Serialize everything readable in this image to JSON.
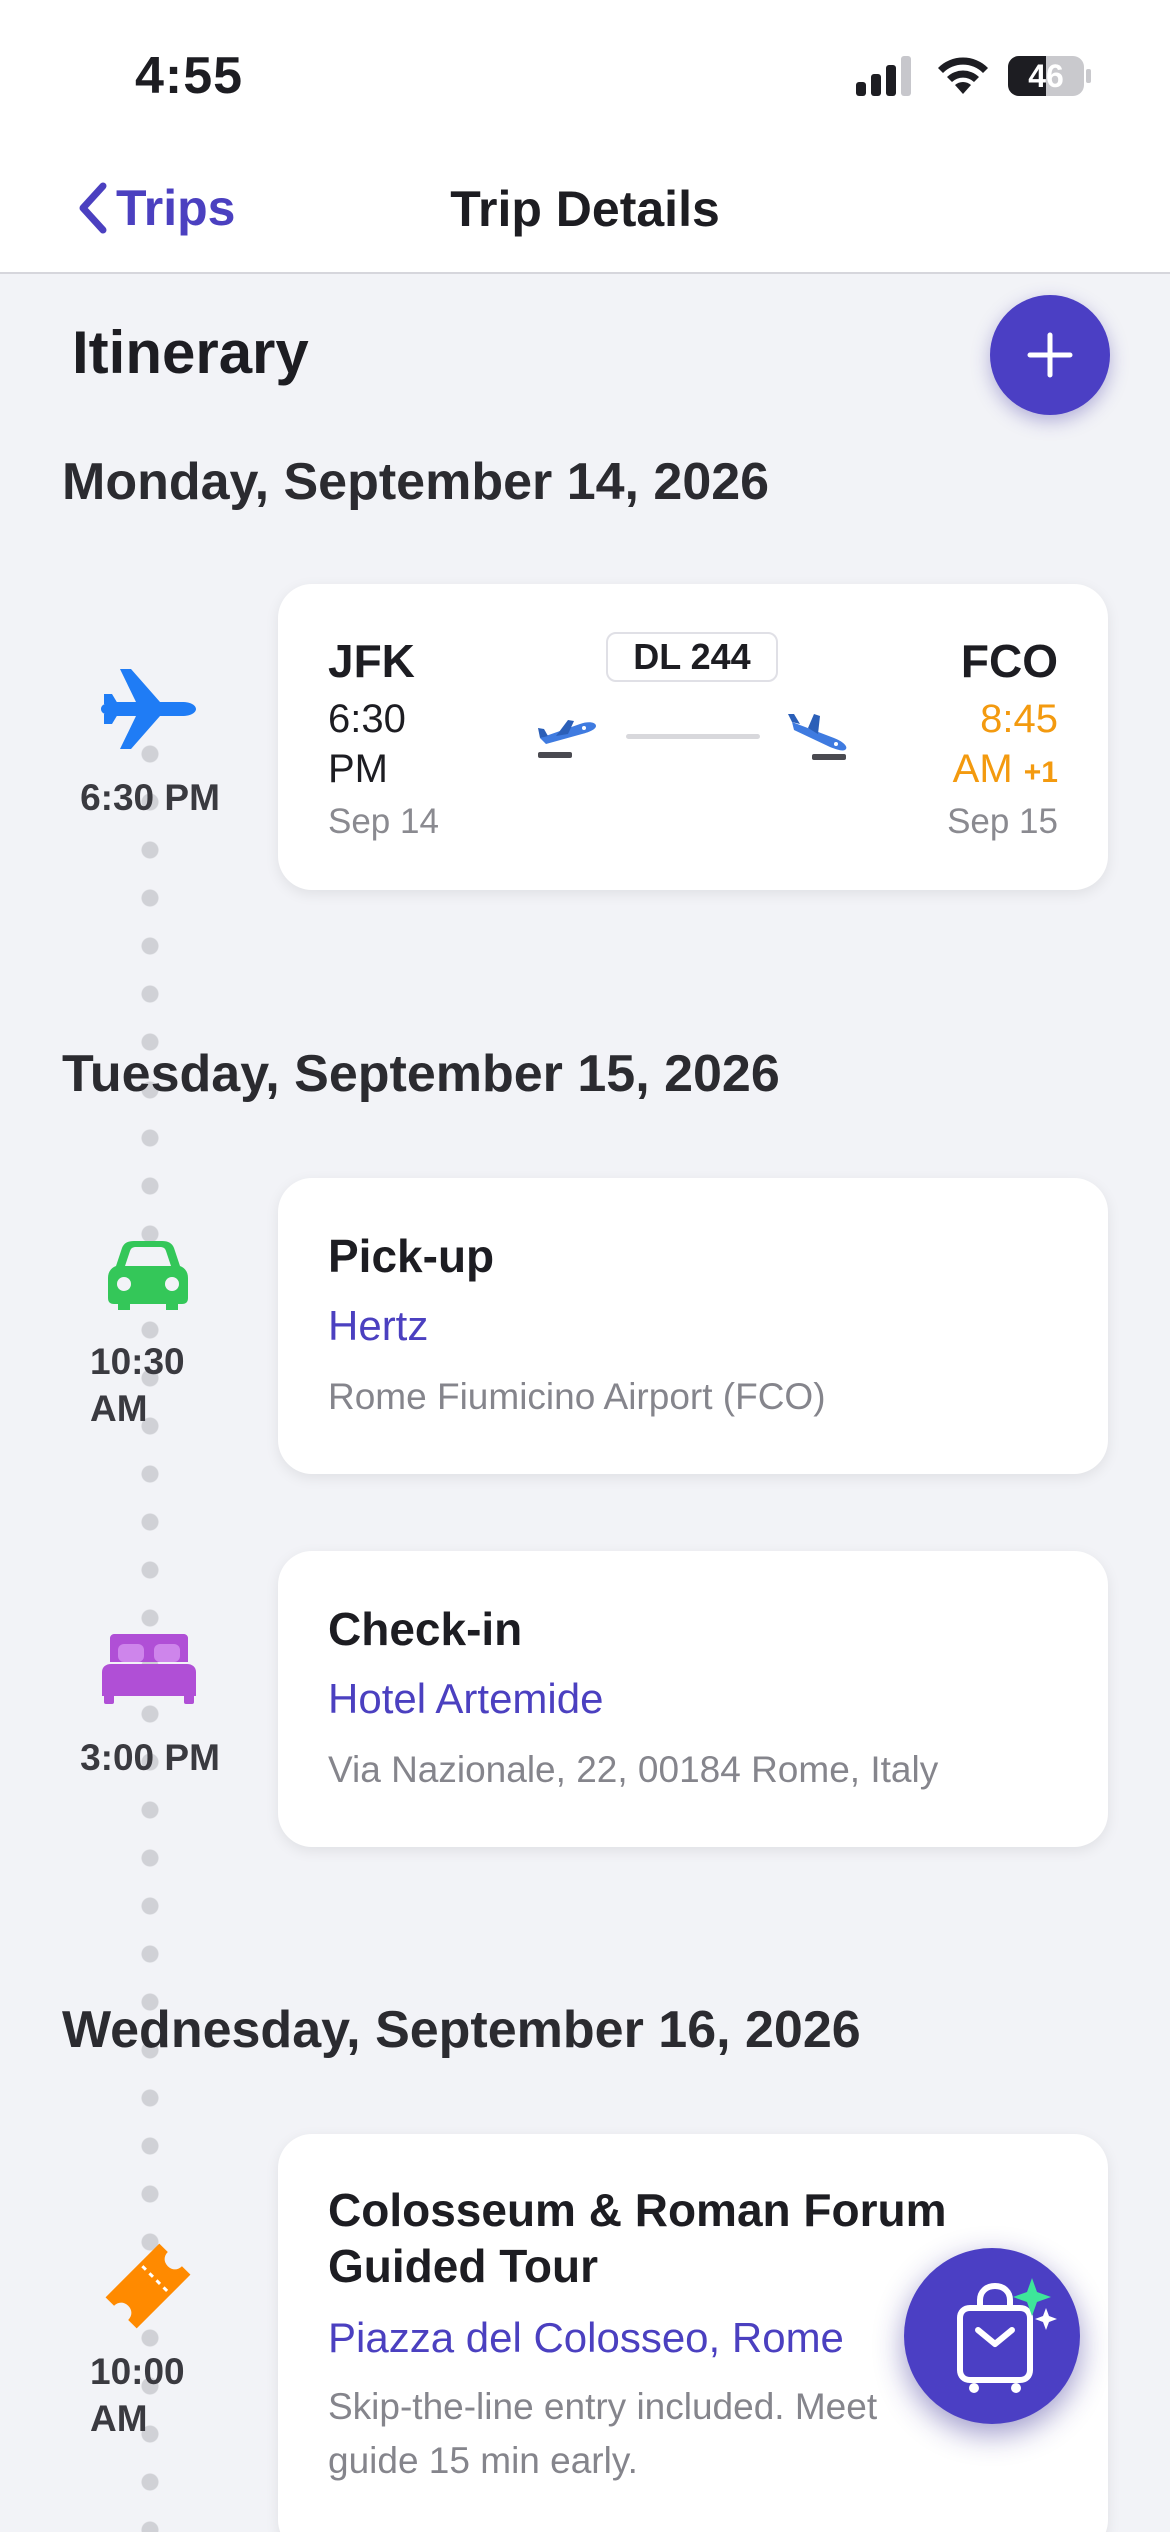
{
  "status_bar": {
    "time": "4:55",
    "battery": "46"
  },
  "nav": {
    "back_label": "Trips",
    "title": "Trip Details"
  },
  "itinerary": {
    "title": "Itinerary"
  },
  "days": [
    {
      "date": "Monday, September 14, 2026"
    },
    {
      "date": "Tuesday, September 15, 2026"
    },
    {
      "date": "Wednesday, September 16, 2026"
    }
  ],
  "flight": {
    "time": "6:30 PM",
    "flight_number": "DL 244",
    "from_code": "JFK",
    "from_time_line1": "6:30",
    "from_time_line2": "PM",
    "from_date": "Sep 14",
    "to_code": "FCO",
    "to_time_line1": "8:45",
    "to_time_line2": "AM",
    "to_day_offset": "+1",
    "to_date": "Sep 15",
    "icon": "airplane-icon",
    "color": "#1f7cf5"
  },
  "events": [
    {
      "time_line1": "10:30",
      "time_line2": "AM",
      "title": "Pick-up",
      "subtitle": "Hertz",
      "meta": "Rome Fiumicino Airport (FCO)",
      "icon": "car-icon",
      "color": "#34c759"
    },
    {
      "time_line1": "3:00 PM",
      "title": "Check-in",
      "subtitle": "Hotel Artemide",
      "meta": "Via Nazionale, 22, 00184 Rome, Italy",
      "icon": "bed-icon",
      "color": "#b04fd6"
    },
    {
      "time_line1": "10:00",
      "time_line2": "AM",
      "title_line1": "Colosseum & Roman Forum",
      "title_line2": "Guided Tour",
      "subtitle": "Piazza del Colosseo, Rome",
      "meta_line1": "Skip-the-line entry included. Meet",
      "meta_line2": "guide 15 min early.",
      "icon": "ticket-icon",
      "color": "#ff8a00"
    }
  ],
  "colors": {
    "accent": "#4b3fc4",
    "arrival": "#f39a0f",
    "background": "#f2f3f7"
  }
}
